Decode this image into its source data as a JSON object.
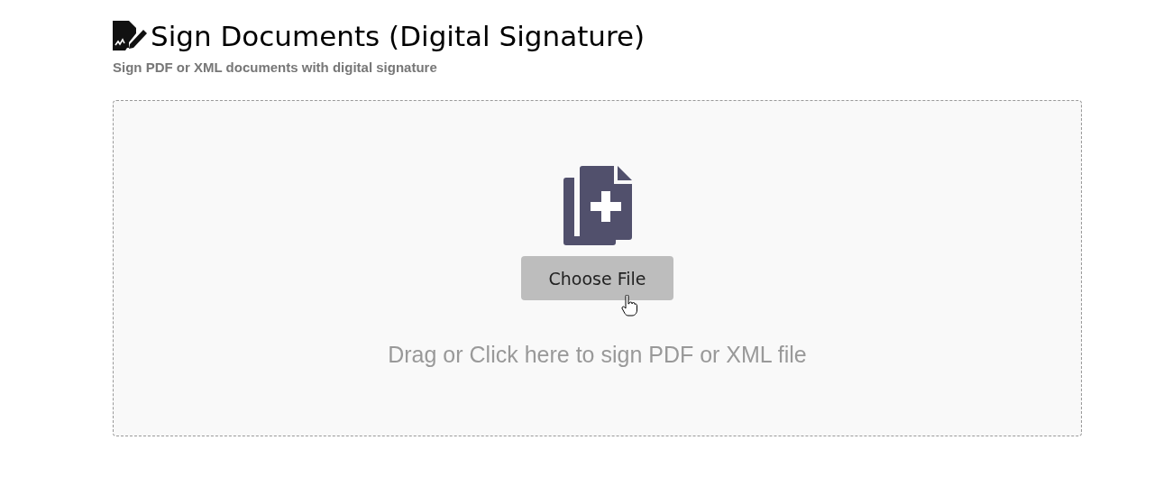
{
  "header": {
    "title": "Sign Documents (Digital Signature)",
    "subtitle": "Sign PDF or XML documents with digital signature"
  },
  "dropzone": {
    "button": "Choose File",
    "hint": "Drag or Click here to sign PDF or XML file"
  }
}
